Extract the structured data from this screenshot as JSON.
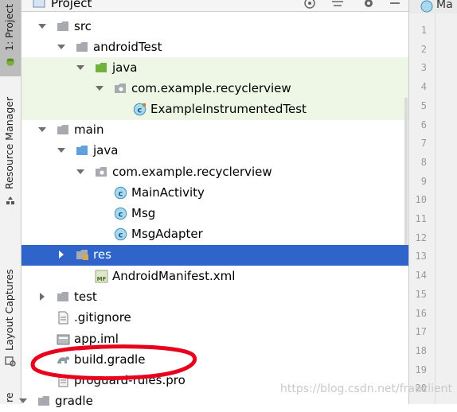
{
  "tool_strip": {
    "project_tab": "1: Project",
    "resource_manager_tab": "Resource Manager",
    "layout_captures_tab": "Layout Captures",
    "bottom_partial_tab": "re"
  },
  "project_panel": {
    "title": "Project",
    "icons": [
      "target-icon",
      "collapse-all-icon",
      "gear-icon",
      "hide-icon"
    ]
  },
  "editor": {
    "tab_label": "Ma",
    "line_numbers": [
      "1",
      "2",
      "3",
      "4",
      "5",
      "6",
      "7",
      "8",
      "9",
      "10",
      "11",
      "12",
      "13",
      "14",
      "15",
      "16",
      "17",
      "18",
      "19",
      "20"
    ]
  },
  "tree": [
    {
      "label": "src",
      "icon": "folder-icon",
      "arrow": "expanded"
    },
    {
      "label": "androidTest",
      "icon": "folder-icon",
      "arrow": "expanded"
    },
    {
      "label": "java",
      "icon": "green-folder-icon",
      "arrow": "expanded"
    },
    {
      "label": "com.example.recyclerview",
      "icon": "package-icon",
      "arrow": "expanded"
    },
    {
      "label": "ExampleInstrumentedTest",
      "icon": "class-test-icon",
      "arrow": "none"
    },
    {
      "label": "main",
      "icon": "folder-icon",
      "arrow": "expanded"
    },
    {
      "label": "java",
      "icon": "blue-folder-icon",
      "arrow": "expanded"
    },
    {
      "label": "com.example.recyclerview",
      "icon": "package-icon",
      "arrow": "expanded"
    },
    {
      "label": "MainActivity",
      "icon": "class-icon",
      "arrow": "none"
    },
    {
      "label": "Msg",
      "icon": "class-icon",
      "arrow": "none"
    },
    {
      "label": "MsgAdapter",
      "icon": "class-icon",
      "arrow": "none"
    },
    {
      "label": "res",
      "icon": "res-folder-icon",
      "arrow": "collapsed",
      "selected": true
    },
    {
      "label": "AndroidManifest.xml",
      "icon": "manifest-icon",
      "arrow": "none"
    },
    {
      "label": "test",
      "icon": "folder-icon",
      "arrow": "collapsed"
    },
    {
      "label": ".gitignore",
      "icon": "file-icon",
      "arrow": "none"
    },
    {
      "label": "app.iml",
      "icon": "iml-icon",
      "arrow": "none"
    },
    {
      "label": "build.gradle",
      "icon": "gradle-icon",
      "arrow": "none"
    },
    {
      "label": "proguard-rules.pro",
      "icon": "file-icon",
      "arrow": "none"
    },
    {
      "label": "gradle",
      "icon": "folder-icon",
      "arrow": "expanded"
    }
  ],
  "manifest_badge": "MF",
  "watermark": "https://blog.csdn.net/franzlient",
  "colors": {
    "selection": "#2f65ca",
    "test_band": "#eef7e6",
    "annotation_red": "#e8001c"
  }
}
